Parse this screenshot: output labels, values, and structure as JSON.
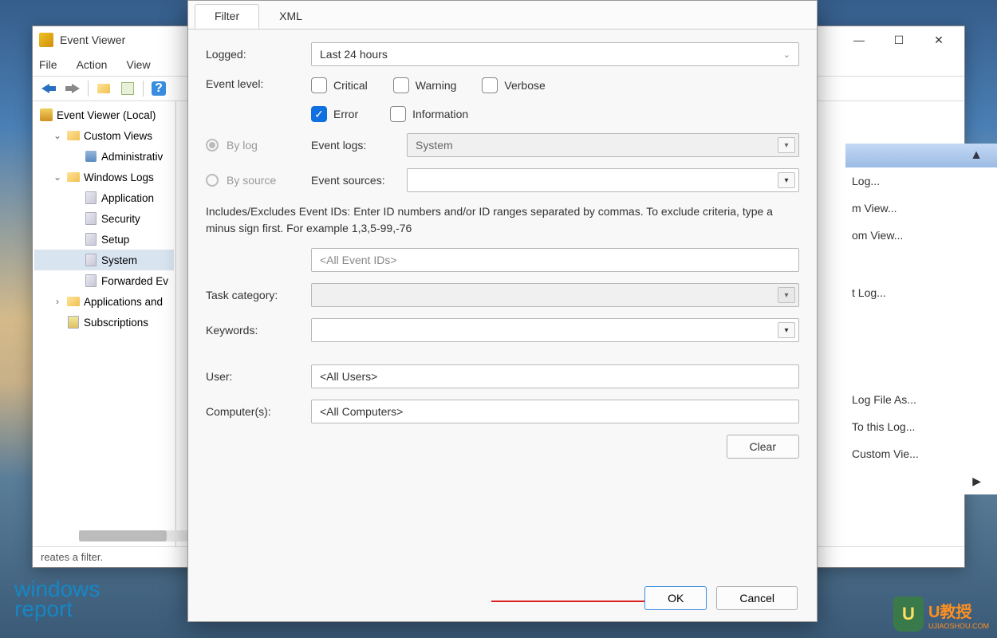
{
  "mainWindow": {
    "title": "Event Viewer",
    "menus": [
      "File",
      "Action",
      "View"
    ],
    "winControls": {
      "min": "—",
      "max": "☐",
      "close": "✕"
    }
  },
  "tree": {
    "root": "Event Viewer (Local)",
    "customViews": "Custom Views",
    "adminEvents": "Administrativ",
    "winLogs": "Windows Logs",
    "application": "Application",
    "security": "Security",
    "setup": "Setup",
    "system": "System",
    "forwarded": "Forwarded Ev",
    "appsServices": "Applications and",
    "subscriptions": "Subscriptions"
  },
  "actions": {
    "header": "",
    "items": [
      "Log...",
      "m View...",
      "om View...",
      "t Log...",
      "Log File As...",
      "To this Log...",
      "Custom Vie..."
    ]
  },
  "status": "reates a filter.",
  "dialog": {
    "tabs": {
      "filter": "Filter",
      "xml": "XML"
    },
    "labels": {
      "logged": "Logged:",
      "eventLevel": "Event level:",
      "byLog": "By log",
      "bySource": "By source",
      "eventLogs": "Event logs:",
      "eventSources": "Event sources:",
      "taskCategory": "Task category:",
      "keywords": "Keywords:",
      "user": "User:",
      "computers": "Computer(s):"
    },
    "values": {
      "logged": "Last 24 hours",
      "eventLogs": "System",
      "eventSources": "",
      "eventIds": "<All Event IDs>",
      "taskCategory": "",
      "keywords": "",
      "user": "<All Users>",
      "computers": "<All Computers>"
    },
    "checkboxes": {
      "critical": "Critical",
      "warning": "Warning",
      "verbose": "Verbose",
      "error": "Error",
      "information": "Information"
    },
    "helpText": "Includes/Excludes Event IDs: Enter ID numbers and/or ID ranges separated by commas. To exclude criteria, type a minus sign first. For example 1,3,5-99,-76",
    "buttons": {
      "clear": "Clear",
      "ok": "OK",
      "cancel": "Cancel"
    }
  },
  "watermarks": {
    "left1": "windows",
    "left2": "report",
    "rightBadge": "U",
    "rightText": "U教授",
    "rightSub": "UJIAOSHOU.COM"
  }
}
